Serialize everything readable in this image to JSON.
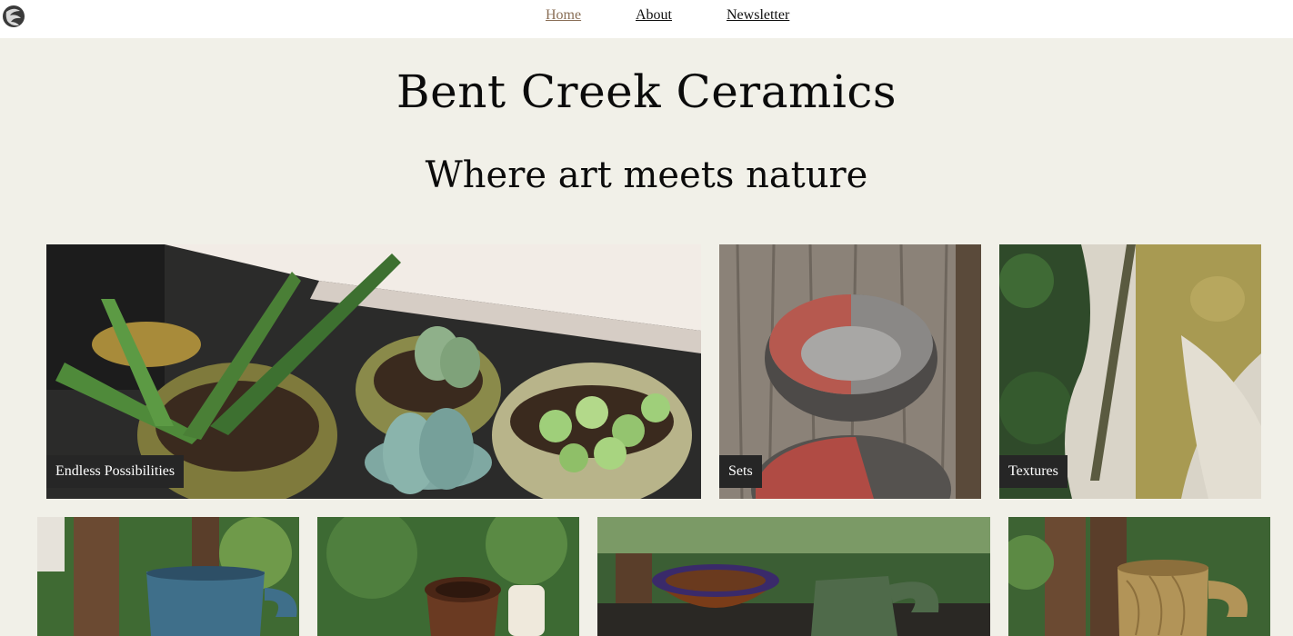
{
  "nav": {
    "items": [
      {
        "label": "Home",
        "active": true
      },
      {
        "label": "About",
        "active": false
      },
      {
        "label": "Newsletter",
        "active": false
      }
    ]
  },
  "header": {
    "title": "Bent Creek Ceramics",
    "tagline": "Where art meets nature"
  },
  "gallery": {
    "featured": [
      {
        "caption": "Endless Possibilities",
        "image": "potted succulents and aloe"
      },
      {
        "caption": "Sets",
        "image": "red and grey bowls on weathered wood"
      },
      {
        "caption": "Textures",
        "image": "glazed ceramic surface detail"
      }
    ],
    "more": [
      {
        "image": "blue speckled mug outdoors"
      },
      {
        "image": "brown vase outdoors"
      },
      {
        "image": "bowl and green pitcher on table"
      },
      {
        "image": "textured yellow mug outdoors"
      }
    ]
  },
  "colors": {
    "page_background": "#f1f0e8",
    "topbar_background": "#ffffff",
    "active_link": "#8a6f57",
    "caption_background": "#262626"
  },
  "icons": {
    "logo": "swirl-logo-icon"
  }
}
